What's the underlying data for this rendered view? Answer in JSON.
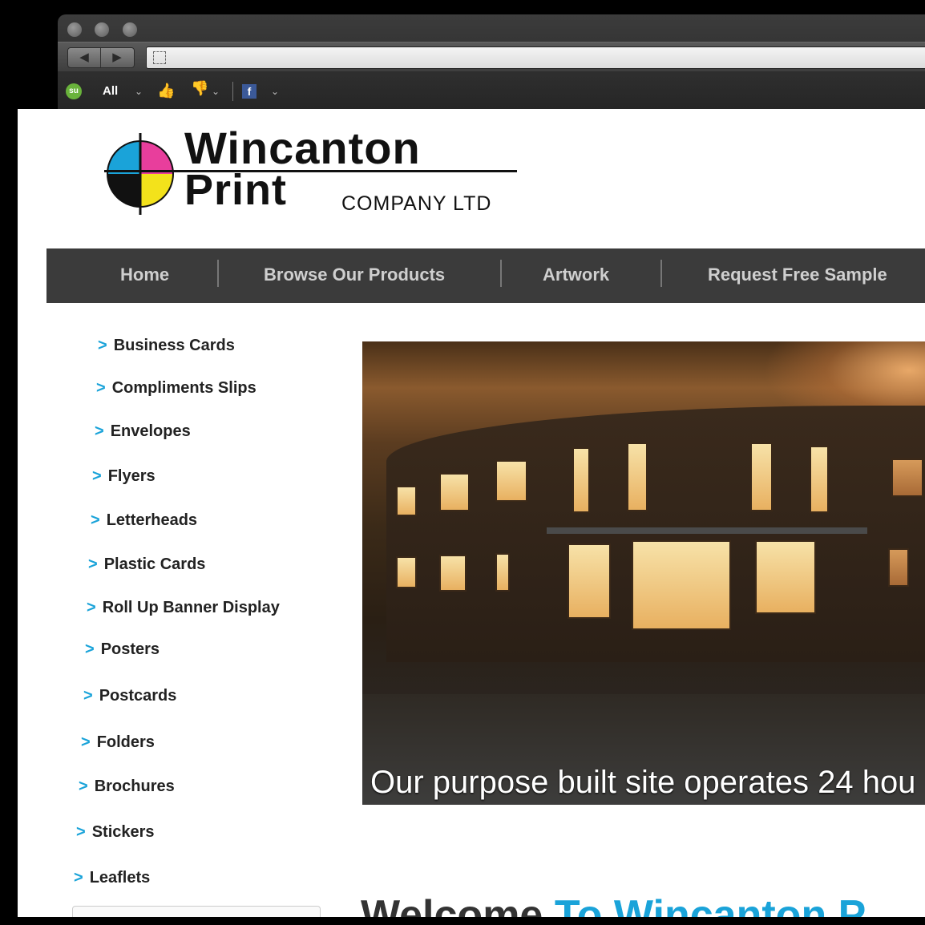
{
  "toolbar": {
    "all_label": "All"
  },
  "logo": {
    "line1": "Wincanton",
    "line2": "Print",
    "line3": "COMPANY LTD"
  },
  "nav": {
    "items": [
      "Home",
      "Browse Our Products",
      "Artwork",
      "Request Free Sample"
    ]
  },
  "sidebar": {
    "arrow": ">",
    "items": [
      "Business Cards",
      "Compliments Slips",
      "Envelopes",
      "Flyers",
      "Letterheads",
      "Plastic Cards",
      "Roll Up Banner Display",
      "Posters",
      "Postcards",
      "Folders",
      "Brochures",
      "Stickers",
      "Leaflets"
    ]
  },
  "hero": {
    "caption": "Our purpose built site operates 24 hou"
  },
  "welcome": {
    "part1": "Welcome",
    "part2": "To Wincanton P"
  },
  "colors": {
    "accent": "#1aa3d9",
    "navbar": "#3b3b3b"
  }
}
